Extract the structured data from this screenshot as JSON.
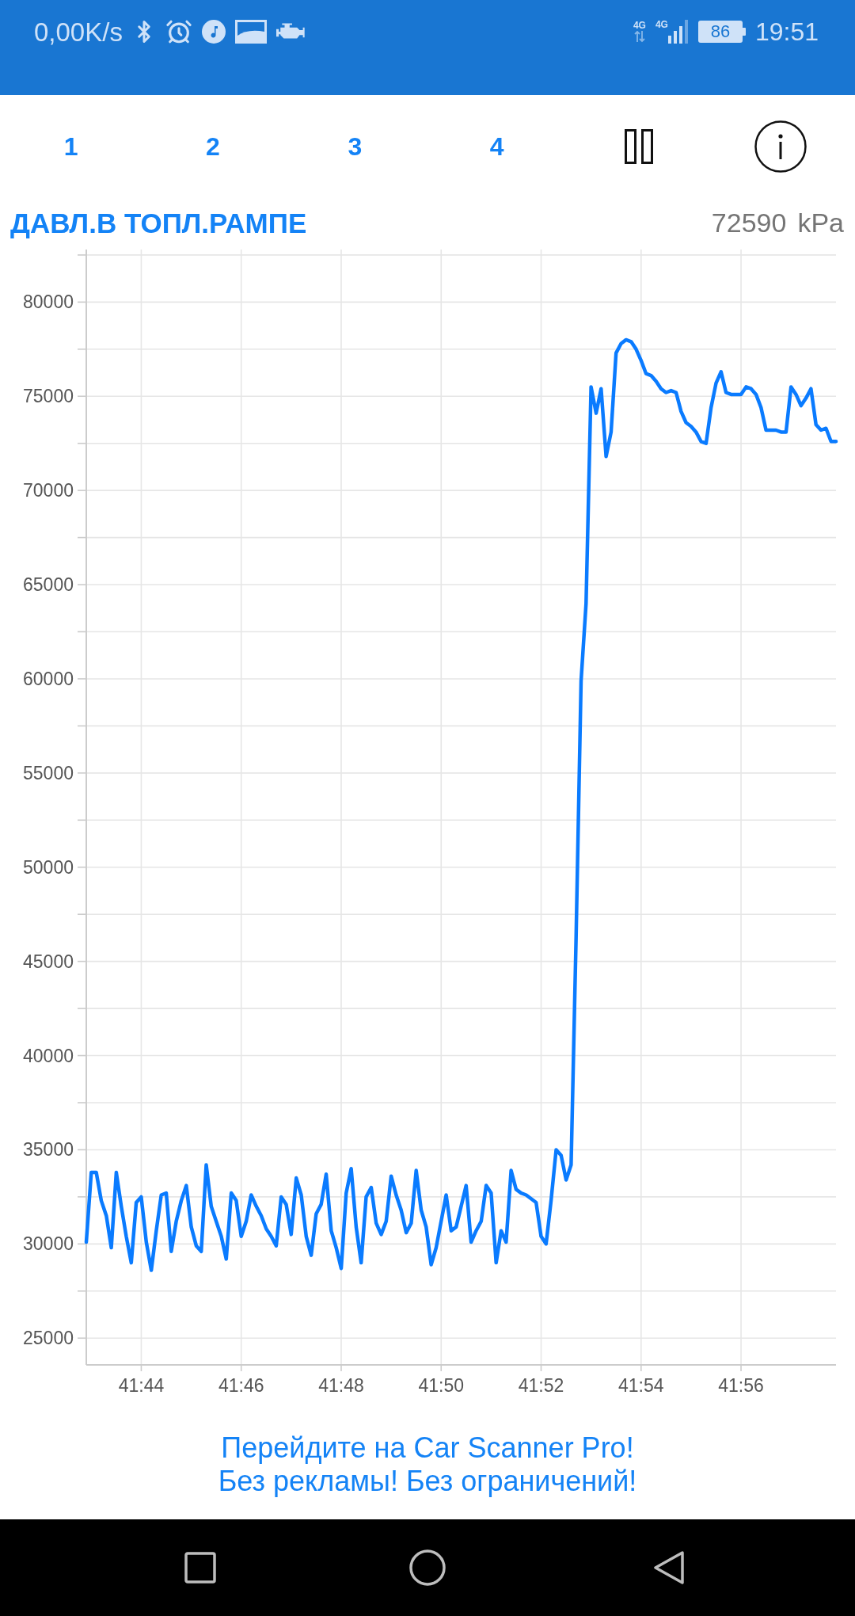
{
  "status_bar": {
    "network_speed": "0,00K/s",
    "network_type_1": "4G",
    "network_type_2": "4G",
    "battery": "86",
    "time": "19:51"
  },
  "tabs": [
    {
      "label": "1"
    },
    {
      "label": "2"
    },
    {
      "label": "3"
    },
    {
      "label": "4"
    }
  ],
  "gauge": {
    "title": "ДАВЛ.В ТОПЛ.РАМПЕ",
    "value": "72590",
    "unit": "kPa",
    "chart_data": {
      "type": "line",
      "grid": true,
      "categories": [
        null,
        null,
        null,
        null,
        null,
        null,
        null,
        null,
        null,
        null,
        null,
        "41:44",
        null,
        null,
        null,
        null,
        null,
        null,
        null,
        null,
        null,
        null,
        null,
        null,
        null,
        null,
        null,
        null,
        null,
        null,
        null,
        "41:46",
        null,
        null,
        null,
        null,
        null,
        null,
        null,
        null,
        null,
        null,
        null,
        null,
        null,
        null,
        null,
        null,
        null,
        null,
        null,
        "41:48",
        null,
        null,
        null,
        null,
        null,
        null,
        null,
        null,
        null,
        null,
        null,
        null,
        null,
        null,
        null,
        null,
        null,
        null,
        null,
        "41:50",
        null,
        null,
        null,
        null,
        null,
        null,
        null,
        null,
        null,
        null,
        null,
        null,
        null,
        null,
        null,
        null,
        null,
        null,
        null,
        "41:52",
        null,
        null,
        null,
        null,
        null,
        null,
        null,
        null,
        null,
        null,
        null,
        null,
        null,
        null,
        null,
        null,
        null,
        null,
        null,
        "41:54",
        null,
        null,
        null,
        null,
        null,
        null,
        null,
        null,
        null,
        null,
        null,
        null,
        null,
        null,
        null,
        null,
        null,
        null,
        null,
        "41:56",
        null,
        null,
        null,
        null,
        null,
        null,
        null,
        null,
        null,
        null,
        null,
        null,
        null,
        null,
        null,
        null,
        null,
        null,
        null
      ],
      "series": [
        {
          "color": "#0a7bff",
          "values": [
            30100,
            33800,
            33800,
            32300,
            31500,
            29800,
            33800,
            32000,
            30400,
            29000,
            32200,
            32500,
            30100,
            28600,
            30700,
            32600,
            32700,
            29600,
            31200,
            32300,
            33100,
            30900,
            29900,
            29600,
            34200,
            32000,
            31200,
            30400,
            29200,
            32700,
            32300,
            30400,
            31200,
            32600,
            32000,
            31500,
            30800,
            30400,
            29900,
            32500,
            32100,
            30500,
            33500,
            32600,
            30400,
            29400,
            31600,
            32100,
            33700,
            30700,
            29800,
            28700,
            32700,
            34000,
            30900,
            29000,
            32500,
            33000,
            31100,
            30500,
            31200,
            33600,
            32600,
            31800,
            30600,
            31100,
            33900,
            31800,
            30900,
            28900,
            29800,
            31200,
            32600,
            30700,
            30900,
            32000,
            33100,
            30100,
            30700,
            31200,
            33100,
            32700,
            29000,
            30700,
            30100,
            33900,
            32900,
            32700,
            32600,
            32400,
            32200,
            30400,
            30000,
            32300,
            35000,
            34700,
            33400,
            34200,
            46300,
            59900,
            64000,
            75500,
            74100,
            75400,
            71800,
            73100,
            77300,
            77800,
            78000,
            77900,
            77500,
            76900,
            76200,
            76100,
            75800,
            75400,
            75200,
            75300,
            75200,
            74200,
            73600,
            73400,
            73100,
            72600,
            72500,
            74400,
            75700,
            76300,
            75200,
            75100,
            75100,
            75100,
            75500,
            75400,
            75100,
            74400,
            73200,
            73200,
            73200,
            73100,
            73100,
            75500,
            75100,
            74500,
            74900,
            75400,
            73500,
            73200,
            73300,
            72600,
            72600
          ]
        }
      ],
      "ylim": [
        23580,
        82790
      ],
      "yticks": [
        25000,
        30000,
        35000,
        40000,
        45000,
        50000,
        55000,
        60000,
        65000,
        70000,
        75000,
        80000
      ]
    }
  },
  "promo": {
    "lines": [
      "Перейдите на Car Scanner Pro!",
      "Без рекламы! Без ограничений!"
    ]
  }
}
